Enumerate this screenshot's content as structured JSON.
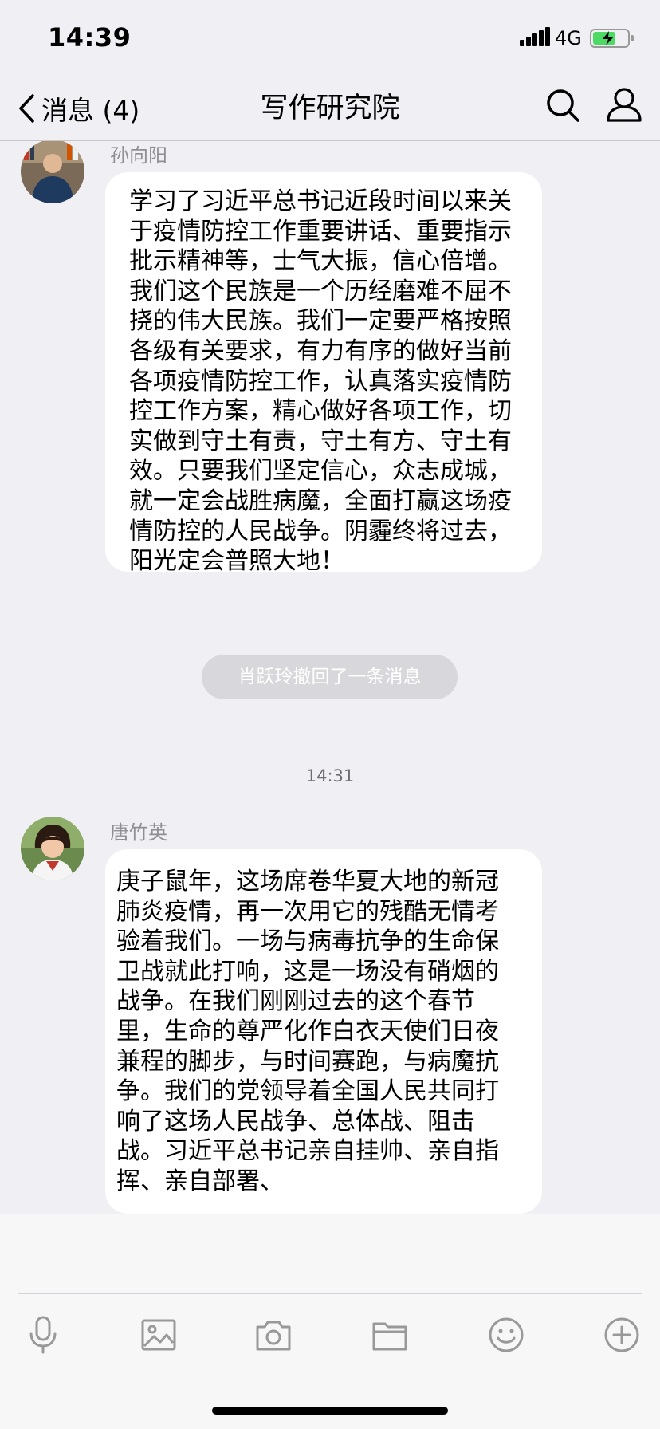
{
  "status_bar": {
    "time": "14:39",
    "network": "4G",
    "icons": [
      "signal-icon",
      "battery-charging-icon"
    ],
    "battery_color": "#4cd964"
  },
  "nav": {
    "back_label": "消息 (4)",
    "title": "写作研究院",
    "icons": [
      "chevron-left-icon",
      "search-icon",
      "profile-icon"
    ]
  },
  "messages": [
    {
      "sender": "孙向阳",
      "text": "学习了习近平总书记近段时间以来关于疫情防控工作重要讲话、重要指示批示精神等，士气大振，信心倍增。我们这个民族是一个历经磨难不屈不挠的伟大民族。我们一定要严格按照各级有关要求，有力有序的做好当前各项疫情防控工作，认真落实疫情防控工作方案，精心做好各项工作，切实做到守土有责，守土有方、守土有效。只要我们坚定信心，众志成城，就一定会战胜病魔，全面打赢这场疫情防控的人民战争。阴霾终将过去，阳光定会普照大地！"
    },
    {
      "sender": "唐竹英",
      "text": "庚子鼠年，这场席卷华夏大地的新冠肺炎疫情，再一次用它的残酷无情考验着我们。一场与病毒抗争的生命保卫战就此打响，这是一场没有硝烟的战争。在我们刚刚过去的这个春节里，生命的尊严化作白衣天使们日夜兼程的脚步，与时间赛跑，与病魔抗争。我们的党领导着全国人民共同打响了这场人民战争、总体战、阻击战。习近平总书记亲自挂帅、亲自指挥、亲自部署、"
    }
  ],
  "system_notice": "肖跃玲撤回了一条消息",
  "timestamp": "14:31",
  "toolbar": {
    "icons": [
      "microphone-icon",
      "image-icon",
      "camera-icon",
      "folder-icon",
      "emoji-icon",
      "plus-icon"
    ]
  }
}
